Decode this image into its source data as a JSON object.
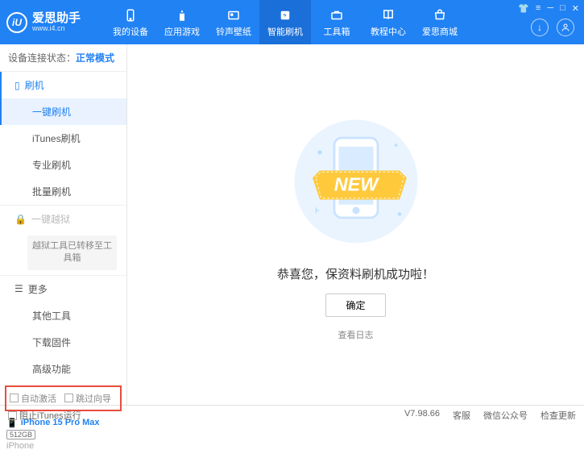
{
  "header": {
    "app_name": "爱思助手",
    "app_url": "www.i4.cn",
    "nav": [
      {
        "label": "我的设备"
      },
      {
        "label": "应用游戏"
      },
      {
        "label": "铃声壁纸"
      },
      {
        "label": "智能刷机"
      },
      {
        "label": "工具箱"
      },
      {
        "label": "教程中心"
      },
      {
        "label": "爱思商城"
      }
    ]
  },
  "sidebar": {
    "status_label": "设备连接状态：",
    "status_value": "正常模式",
    "section_flash": "刷机",
    "items_flash": [
      "一键刷机",
      "iTunes刷机",
      "专业刷机",
      "批量刷机"
    ],
    "section_jailbreak": "一键越狱",
    "jailbreak_notice": "越狱工具已转移至工具箱",
    "section_more": "更多",
    "items_more": [
      "其他工具",
      "下载固件",
      "高级功能"
    ],
    "chk_auto": "自动激活",
    "chk_skip": "跳过向导",
    "device_name": "iPhone 15 Pro Max",
    "device_storage": "512GB",
    "device_type": "iPhone"
  },
  "main": {
    "new_badge": "NEW",
    "success_text": "恭喜您，保资料刷机成功啦！",
    "ok_button": "确定",
    "view_log": "查看日志"
  },
  "footer": {
    "block_itunes": "阻止iTunes运行",
    "version": "V7.98.66",
    "links": [
      "客服",
      "微信公众号",
      "检查更新"
    ]
  }
}
